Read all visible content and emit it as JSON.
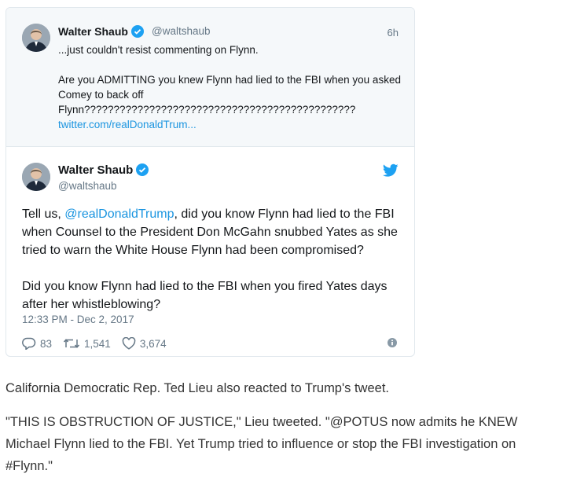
{
  "quoted_tweet": {
    "name": "Walter Shaub",
    "handle": "@waltshaub",
    "time": "6h",
    "line1": "...just couldn't resist commenting on Flynn.",
    "line2": "Are you ADMITTING you knew Flynn had lied to the FBI when you asked Comey to back off Flynn??????????????????????????????????????????????",
    "link": "twitter.com/realDonaldTrum..."
  },
  "tweet": {
    "name": "Walter Shaub",
    "handle": "@waltshaub",
    "text_pre": "Tell us, ",
    "mention": "@realDonaldTrump",
    "text_post": ", did you know Flynn had lied to the FBI when Counsel to the President Don McGahn snubbed Yates as she tried to warn the White House Flynn had been compromised?",
    "paragraph2": "Did you know Flynn had lied to the FBI when you fired Yates days after her whistleblowing?",
    "date": "12:33 PM - Dec 2, 2017",
    "replies": "83",
    "retweets": "1,541",
    "likes": "3,674"
  },
  "article": {
    "paragraph1": "California Democratic Rep. Ted Lieu also reacted to Trump's tweet.",
    "paragraph2": "\"THIS IS OBSTRUCTION OF JUSTICE,\" Lieu tweeted. \"@POTUS now admits he KNEW Michael Flynn lied to the FBI. Yet Trump tried to influence or stop the FBI investigation on #Flynn.\""
  },
  "colors": {
    "link_blue": "#1b95e0",
    "verified_blue": "#1da1f2",
    "muted_gray": "#657786"
  },
  "icons": [
    "verified-badge-icon",
    "twitter-bird-icon",
    "reply-icon",
    "retweet-icon",
    "like-icon",
    "info-icon"
  ]
}
